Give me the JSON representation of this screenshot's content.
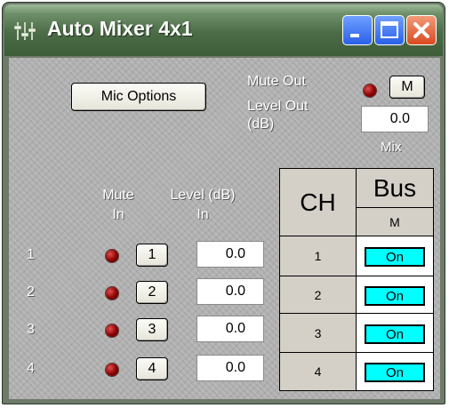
{
  "window": {
    "title": "Auto Mixer 4x1"
  },
  "controls": {
    "mic_options_label": "Mic Options",
    "mute_out_label": "Mute Out",
    "mute_out_button": "M",
    "level_out_label_1": "Level Out",
    "level_out_label_2": "(dB)",
    "level_out_value": "0.0",
    "mix_label": "Mix"
  },
  "inputs_header": {
    "mute_1": "Mute",
    "mute_2": "In",
    "level_1": "Level (dB)",
    "level_2": "In"
  },
  "grid_header": {
    "ch": "CH",
    "bus": "Bus",
    "bus_mute": "M"
  },
  "channels": [
    {
      "row_label": "1",
      "mute_button": "1",
      "level": "0.0",
      "ch": "1",
      "bus_state": "On"
    },
    {
      "row_label": "2",
      "mute_button": "2",
      "level": "0.0",
      "ch": "2",
      "bus_state": "On"
    },
    {
      "row_label": "3",
      "mute_button": "3",
      "level": "0.0",
      "ch": "3",
      "bus_state": "On"
    },
    {
      "row_label": "4",
      "mute_button": "4",
      "level": "0.0",
      "ch": "4",
      "bus_state": "On"
    }
  ],
  "icons": {
    "app": "mixer-icon",
    "minimize": "minimize-icon",
    "maximize": "maximize-icon",
    "close": "close-icon",
    "led": "led-indicator-icon"
  },
  "colors": {
    "titlebar": "#4b6c46",
    "panel": "#afafaf",
    "led": "#8a0000",
    "bus_on": "#00ffff",
    "close_button": "#d84a21",
    "window_buttons": "#2b60e8"
  }
}
